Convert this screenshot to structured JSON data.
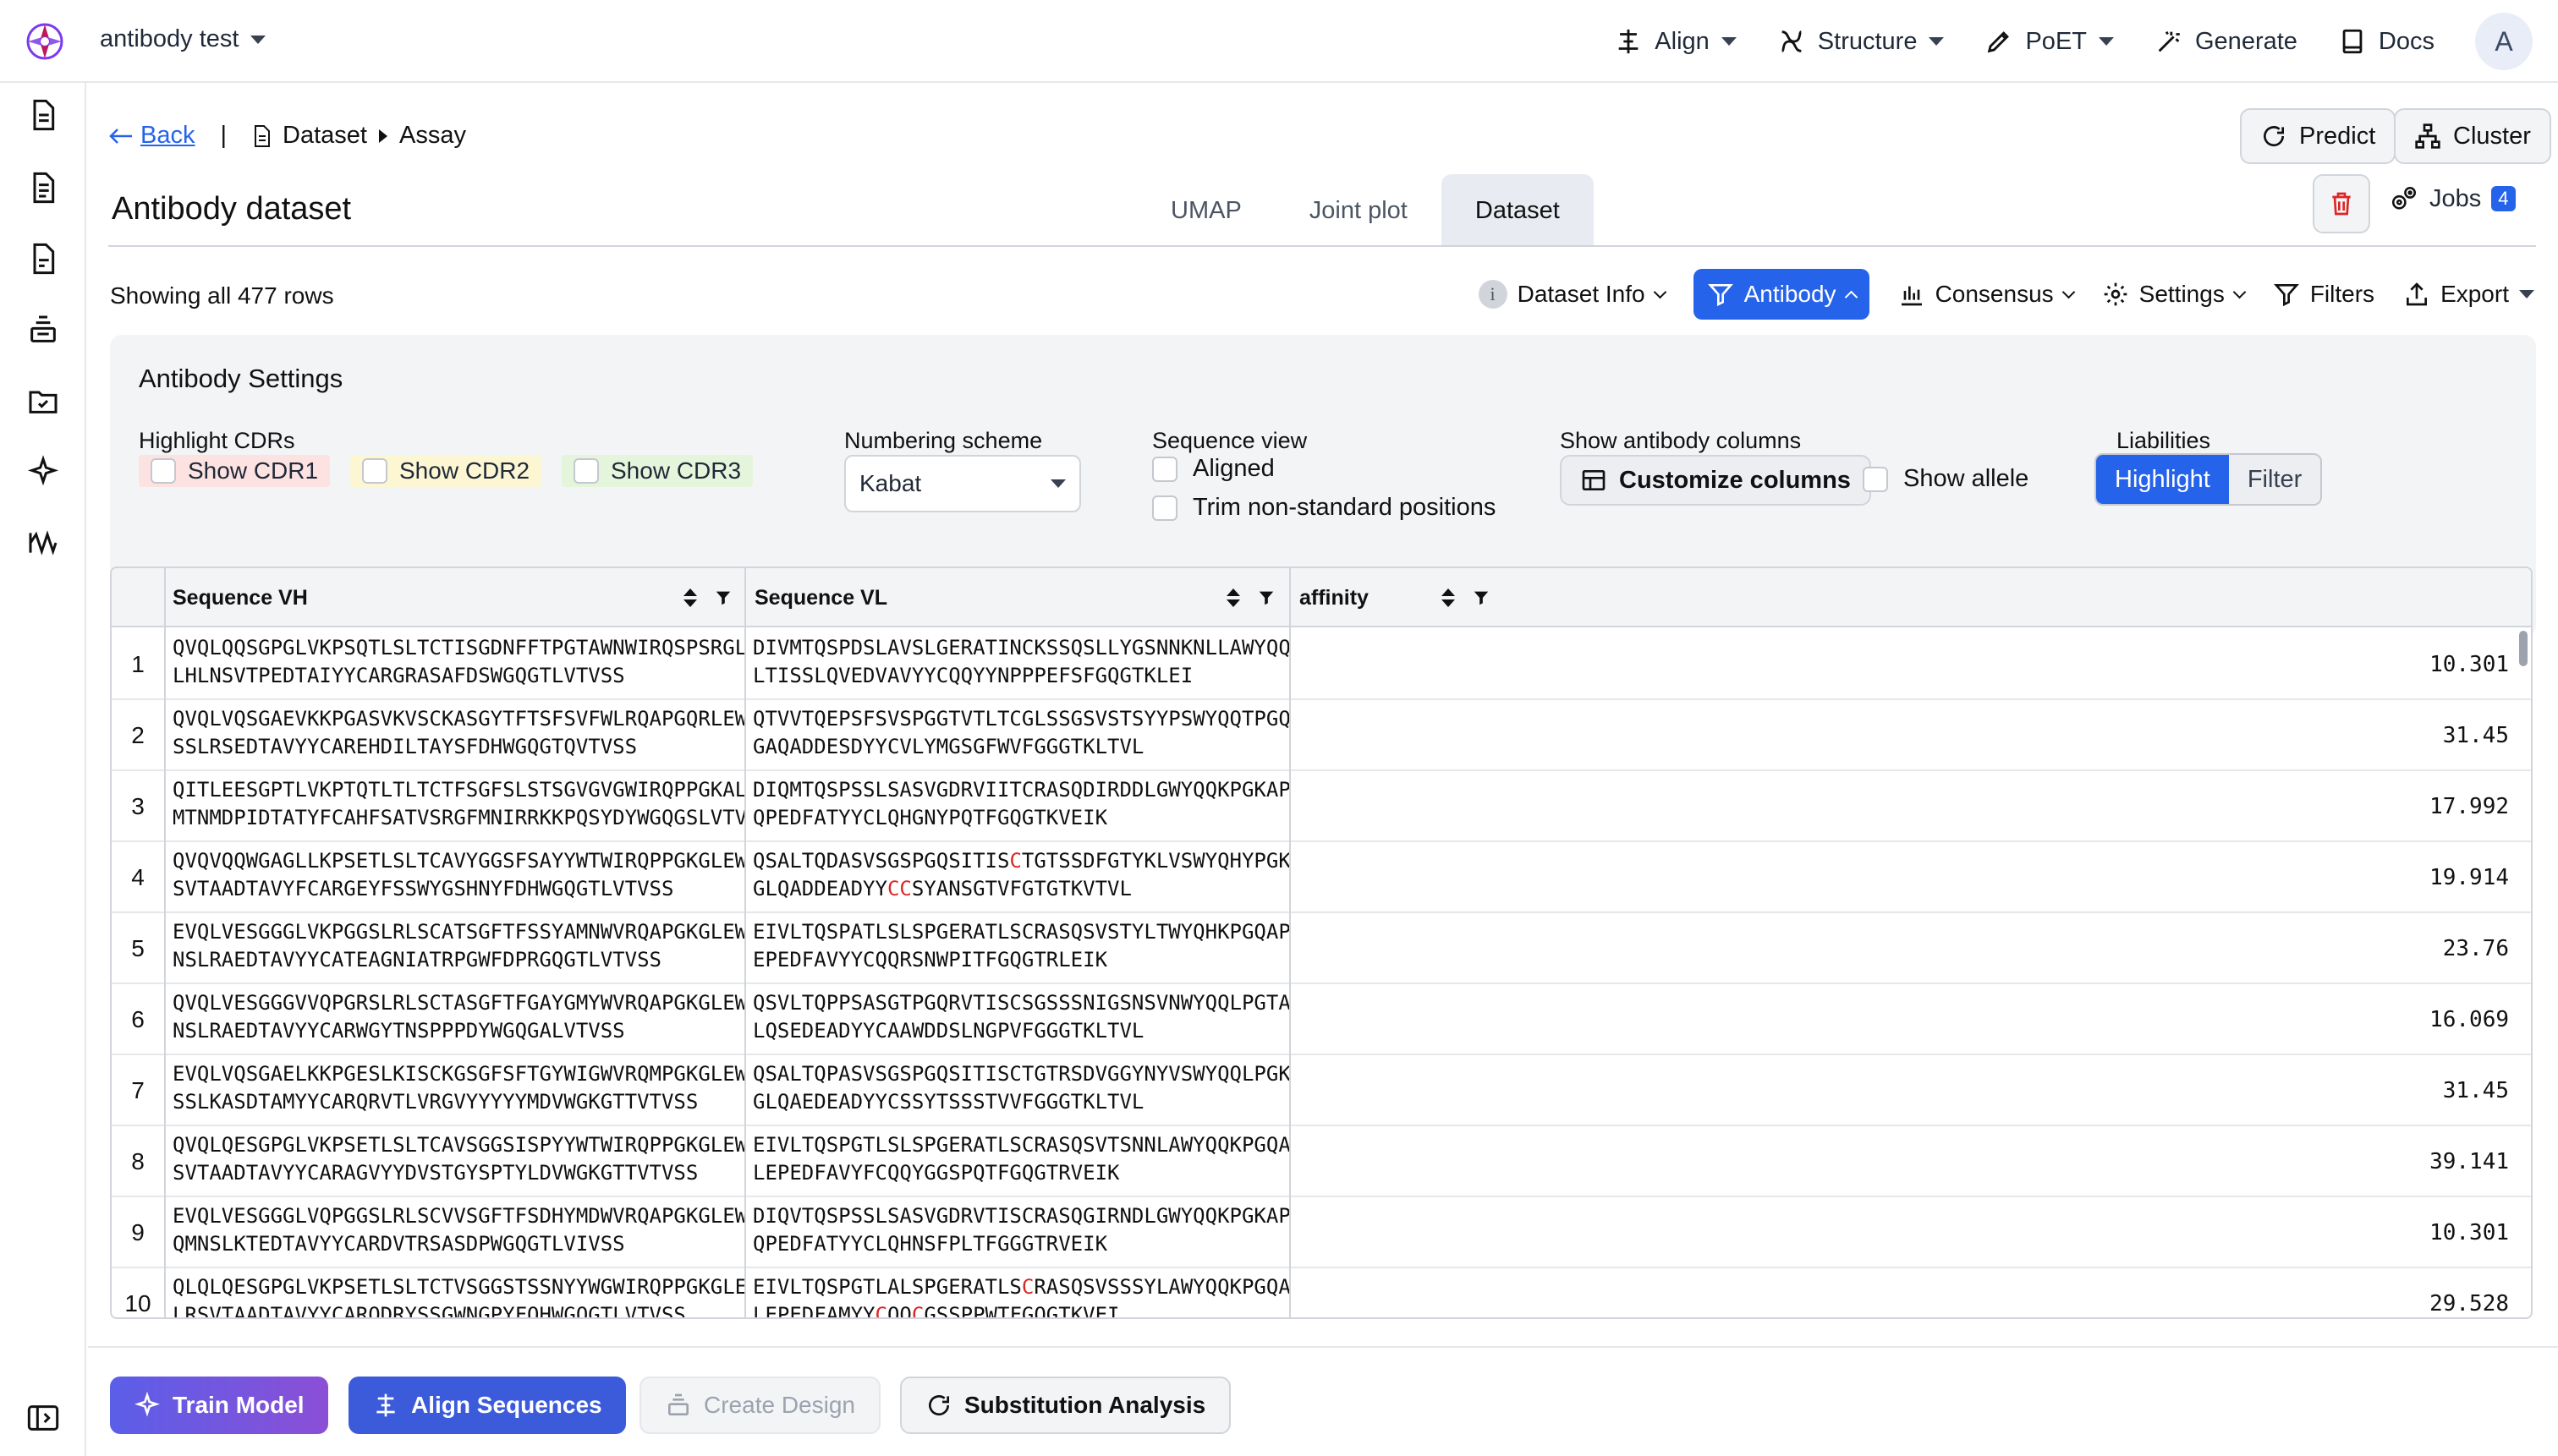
{
  "project": {
    "name": "antibody test"
  },
  "nav": {
    "align": "Align",
    "structure": "Structure",
    "poet": "PoET",
    "generate": "Generate",
    "docs": "Docs",
    "avatar": "A"
  },
  "breadcrumb": {
    "back": "Back",
    "sep": "|",
    "dataset": "Dataset",
    "assay": "Assay"
  },
  "page": {
    "title": "Antibody dataset"
  },
  "tabs": [
    "UMAP",
    "Joint plot",
    "Dataset"
  ],
  "active_tab": "Dataset",
  "actions": {
    "predict": "Predict",
    "cluster": "Cluster",
    "jobs": "Jobs",
    "jobs_count": "4"
  },
  "table_info": {
    "row_count": "Showing all 477 rows"
  },
  "toolbar": {
    "dataset_info": "Dataset Info",
    "info_glyph": "i",
    "antibody": "Antibody",
    "consensus": "Consensus",
    "settings": "Settings",
    "filters": "Filters",
    "export": "Export"
  },
  "antibody_settings": {
    "title": "Antibody Settings",
    "highlight_cdrs_label": "Highlight CDRs",
    "cdr1": "Show CDR1",
    "cdr2": "Show CDR2",
    "cdr3": "Show CDR3",
    "numbering_label": "Numbering scheme",
    "numbering_value": "Kabat",
    "sequence_view_label": "Sequence view",
    "aligned": "Aligned",
    "trim": "Trim non-standard positions",
    "columns_label": "Show antibody columns",
    "customize": "Customize columns",
    "show_allele": "Show allele",
    "liabilities_label": "Liabilities",
    "highlight": "Highlight",
    "filter": "Filter"
  },
  "colors": {
    "accent": "#2563eb",
    "cdr1_bg": "#fde2e2",
    "cdr2_bg": "#fdf6d3",
    "cdr3_bg": "#e4f5dc",
    "liability": "#dc2626"
  },
  "columns": [
    "Sequence VH",
    "Sequence VL",
    "affinity"
  ],
  "rows": [
    {
      "n": "1",
      "vh1": "QVQLQQSGPGLVKPSQTLSLTCTISGDNFFTPGTAWNWIRQSPSRGLEWLGRTYYRSGWYYDYAVSVKSRVTINEDTSKNQFS",
      "vh2": "LHLNSVTPEDTAIYYCARGRASAFDSWGQGTLVTVSS",
      "vl1": "DIVMTQSPDSLAVSLGERATINCKSSQSLLYGSNNKNLLAWYQQKPGRPPKLLIYWASTRESGVPDRFSGSGSGTDFT",
      "vl2": "LTISSLQVEDVAVYYCQQYYNPPPEFSFGQGTKLEI",
      "aff": "10.301"
    },
    {
      "n": "2",
      "vh1": "QVQLVQSGAEVKKPGASVKVSCKASGYTFTSFSVFWLRQAPGQRLEWMGWINAGNGNTKYSEIFQGRVTITRDTSASTAYMEV",
      "vh2": "SSLRSEDTAVYYCAREHDILTAYSFDHWGQGTQVTVSS",
      "vl1": "QTVVTQEPSFSVSPGGTVTLTCGLSSGSVSTSYYPSWYQQTPGQAPRTLIYSTNTRSSGVPDRFSGSILGNRAALTIT",
      "vl2": "GAQADDESDYYCVLYMGSGFWVFGGGTKLTVL",
      "aff": "31.45"
    },
    {
      "n": "3",
      "vh1": "QITLEESGPTLVKPTQTLTLTCTFSGFSLSTSGVGVGWIRQPPGKALEWLALIYWDGNNLYSPSLQNRLTITKDTSKNQVVLT",
      "vh2": "MTNMDPIDTATYFCAHFSATVSRGFMNIRRKKPQSYDYWGQGSLVTVSS",
      "vl1": "DIQMTQSPSSLSASVGDRVIITCRASQDIRDDLGWYQQKPGKAPKRLIYAASSLQSGVPSRFSGSGSGTEFTLTISNL",
      "vl2": "QPEDFATYYCLQHGNYPQTFGQGTKVEIK",
      "aff": "17.992"
    },
    {
      "n": "4",
      "vh1": "QVQVQQWGAGLLKPSETLSLTCAVYGGSFSAYYWTWIRQPPGKGLEWIGEINHGGGTNYNPSLKSRVTISVDTSKNQFSLKLS",
      "vh2": "SVTAADTAVYFCARGEYFSSWYGSHNYFDHWGQGTLVTVSS",
      "vl1a": "QSALTQDASVSGSPGQSITIS",
      "vl1r": "C",
      "vl1b": "TGTSSDFGTYKLVSWYQHYPGKAPKLMIYEGNKRPSGVSNRFSGSTSGNAASLTIS",
      "vl2a": "GLQADDEADYY",
      "vl2r": "CC",
      "vl2b": "SYANSGTVFGTGTKVTVL",
      "aff": "19.914"
    },
    {
      "n": "5",
      "vh1": "EVQLVESGGGLVKPGGSLRLSCATSGFTFSSYAMNWVRQAPGKGLEWVSSISSGSGYIYYADSVKGRFTISRENAKNSLFLQM",
      "vh2": "NSLRAEDTAVYYCATEAGNIATRPGWFDPRGQGTLVTVSS",
      "vl1": "EIVLTQSPATLSLSPGERATLSCRASQSVSTYLTWYQHKPGQAPSLLIYDASNRATGIPARFSGSGSGTDFTLTITTL",
      "vl2": "EPEDFAVYYCQQRSNWPITFGQGTRLEIK",
      "aff": "23.76"
    },
    {
      "n": "6",
      "vh1": "QVQLVESGGGVVQPGRSLRLSCTASGFTFGAYGMYWVRQAPGKGLEWVAVIWYDGGKKYYADSVKGRFTISRDNSENTLYLQM",
      "vh2": "NSLRAEDTAVYYCARWGYTNSPPPDYWGQGALVTVSS",
      "vl1": "QSVLTQPPSASGTPGQRVTISCSGSSSNIGSNSVNWYQQLPGTAPKLLIFSNNQWPSGVPARFSGSKSGTSASLAISG",
      "vl2": "LQSEDEADYYCAAWDDSLNGPVFGGGTKLTVL",
      "aff": "16.069"
    },
    {
      "n": "7",
      "vh1": "EVQLVQSGAELKKPGESLKISCKGSGFSFTGYWIGWVRQMPGKGLEWMGIIYPDDSDTRYSPSFQGQVTISADKSINTAYLQW",
      "vh2": "SSLKASDTAMYYCARQRVTLVRGVYYYYYMDVWGKGTTVTVSS",
      "vl1": "QSALTQPASVSGSPGQSITISCTGTRSDVGGYNYVSWYQQLPGKAPKPMIYDVSNRPSGVSNRFSGSKSGNTASLTIS",
      "vl2": "GLQAEDEADYYCSSYTSSSTVVFGGGTKLTVL",
      "aff": "31.45"
    },
    {
      "n": "8",
      "vh1": "QVQLQESGPGLVKPSETLSLTCAVSGGSISPYYWTWIRQPPGKGLEWIGYIFYSGSTDYNPSLKNRVTISVDTSRNQFSLKLT",
      "vh2": "SVTAADTAVYYCARAGVYYDVSTGYSPTYLDVWGKGTTVTVSS",
      "vl1": "EIVLTQSPGTLSLSPGERATLSCRASQSVTSNNLAWYQQKPGQAPRLLIYDASRRATGIPDRLSGGGSGTDFTLTISR",
      "vl2": "LEPEDFAVYFCQQYGGSPQTFGQGTRVEIK",
      "aff": "39.141"
    },
    {
      "n": "9",
      "vh1": "EVQLVESGGGLVQPGGSLRLSCVVSGFTFSDHYMDWVRQAPGKGLEWVGRSRAKVKGYTTDYAASVKGRFTISRDDSKNSLYL",
      "vh2": "QMNSLKTEDTAVYYCARDVTRSASDPWGQGTLVIVSS",
      "vl1": "DIQVTQSPSSLSASVGDRVTISCRASQGIRNDLGWYQQKPGKAPKLLIYTASSLQSGVPSRFSGSGSGTEFTLTISSL",
      "vl2": "QPEDFATYYCLQHNSFPLTFGGGTRVEIK",
      "aff": "10.301"
    },
    {
      "n": "10",
      "vh1": "QLQLQESGPGLVKPSETLSLTCTVSGGSTSSNYYWGWIRQPPGKGLEWIGSIYYNGETSHNPSLKSRATISVDTSKNQFSLK",
      "vh2": "LRSVTAADTAVYYCARODRYSSGWNGPYFOHWGOGTLVTVSS",
      "vl1a": "EIVLTQSPGTLALSPGERATLS",
      "vl1r": "C",
      "vl1b": "RASQSVSSSYLAWYQQKPGQAPRLLIYGASSRATDTPDRFSGSGSGTDFTLTISR",
      "vl2a": "LEPEDFAMYY",
      "vl2r": "C",
      "vl2b": "QQ",
      "vl2r2": "C",
      "vl2c": "GSSPPWTFGQGTKVEI",
      "aff": "29.528"
    }
  ],
  "bottom_actions": {
    "train": "Train Model",
    "align": "Align Sequences",
    "design": "Create Design",
    "substitution": "Substitution Analysis"
  }
}
